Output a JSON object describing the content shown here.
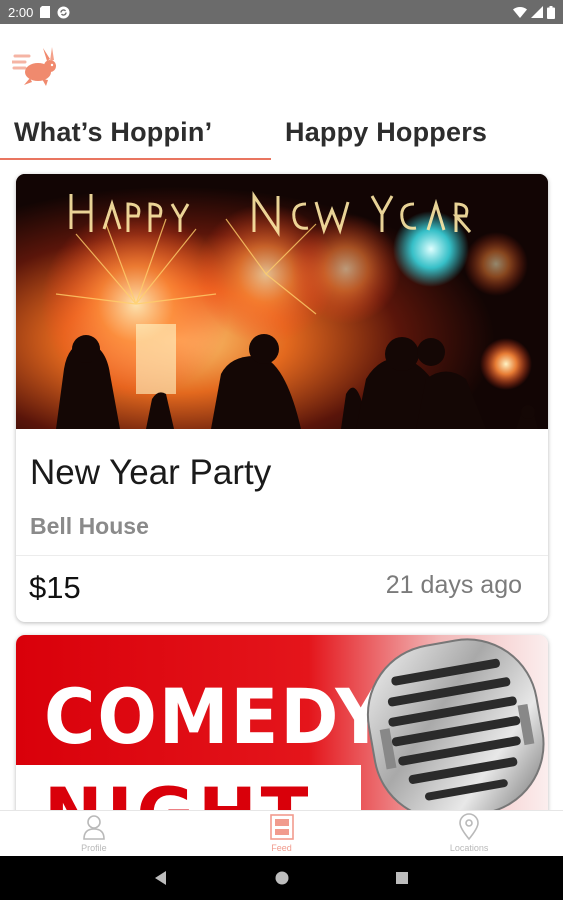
{
  "status_bar": {
    "time": "2:00"
  },
  "tabs": [
    {
      "label": "What’s Hoppin’",
      "active": true
    },
    {
      "label": "Happy Hoppers",
      "active": false
    }
  ],
  "events": [
    {
      "image_text": "Happy New Year",
      "title": "New Year Party",
      "venue": "Bell House",
      "price": "$15",
      "posted": "21 days ago"
    },
    {
      "image_text": [
        "COMEDY",
        "NIGHT"
      ]
    }
  ],
  "bottom_nav": [
    {
      "label": "Profile",
      "icon": "person-icon",
      "active": false
    },
    {
      "label": "Feed",
      "icon": "feed-icon",
      "active": true
    },
    {
      "label": "Locations",
      "icon": "location-pin-icon",
      "active": false
    }
  ],
  "colors": {
    "accent": "#e97560",
    "status_bar": "#6b6b6b",
    "nav_inactive": "#b9b9b9",
    "nav_active": "#f19b8d"
  }
}
